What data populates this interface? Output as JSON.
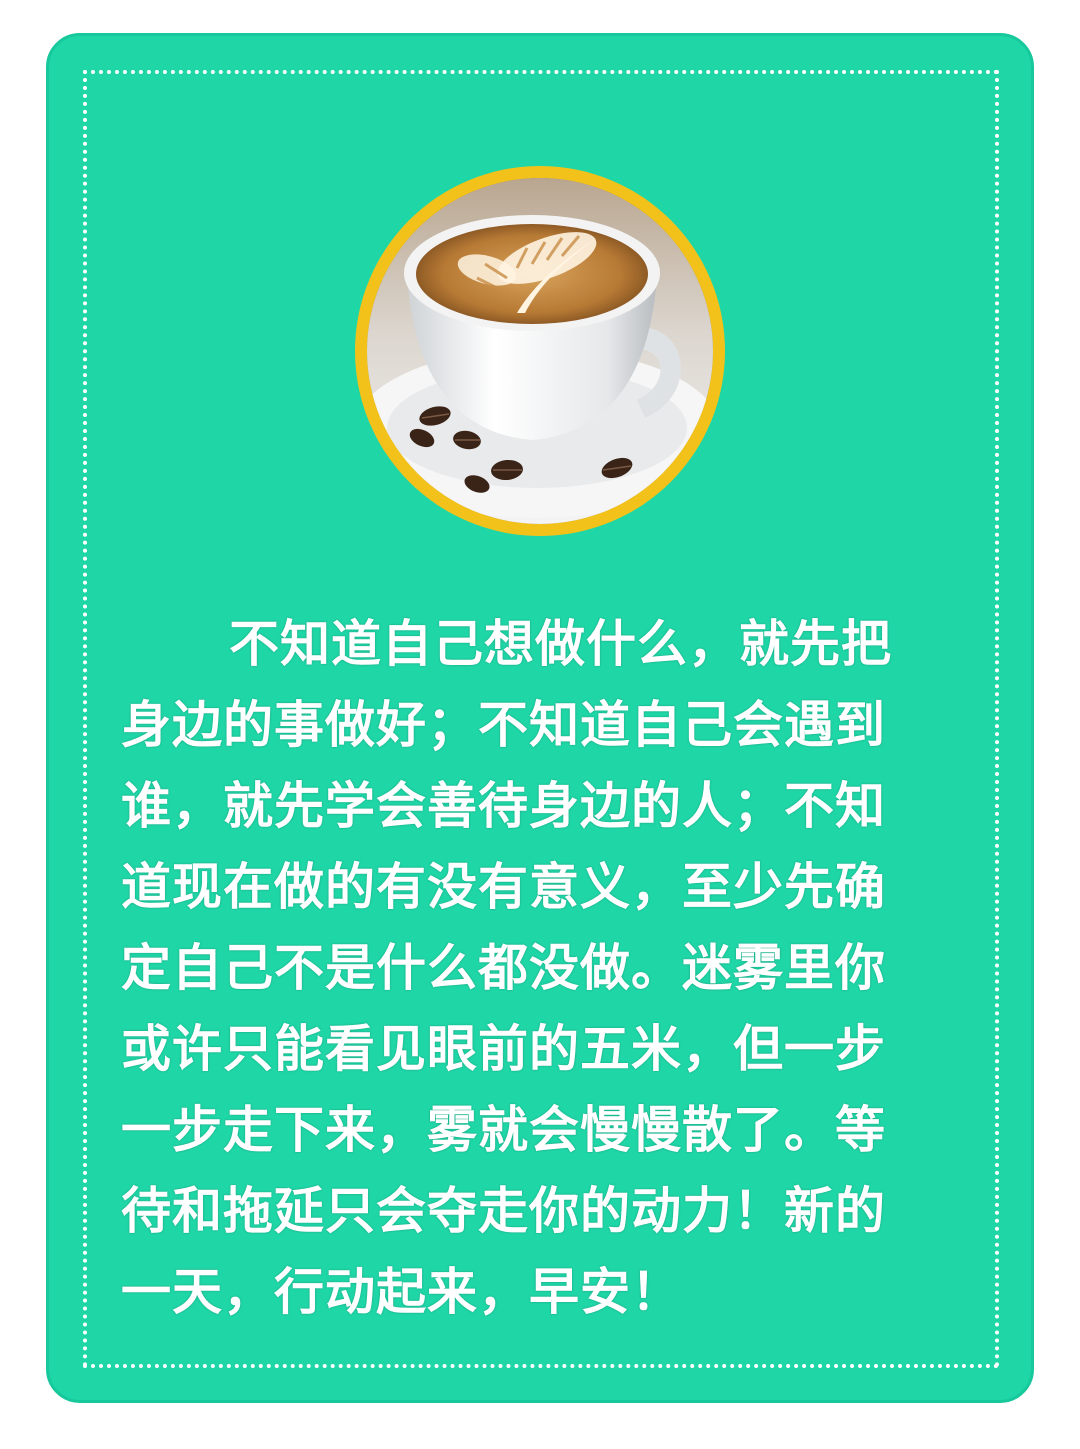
{
  "photo": {
    "icon": "coffee-cup-latte-art-icon",
    "ring_color": "#f2c21b"
  },
  "colors": {
    "card_background": "#1fd6a7",
    "text": "#ffffff"
  },
  "message": "不知道自己想做什么，就先把身边的事做好；不知道自己会遇到谁，就先学会善待身边的人；不知道现在做的有没有意义，至少先确定自己不是什么都没做。迷雾里你或许只能看见眼前的五米，但一步一步走下来，雾就会慢慢散了。等待和拖延只会夺走你的动力！新的一天，行动起来，早安！"
}
